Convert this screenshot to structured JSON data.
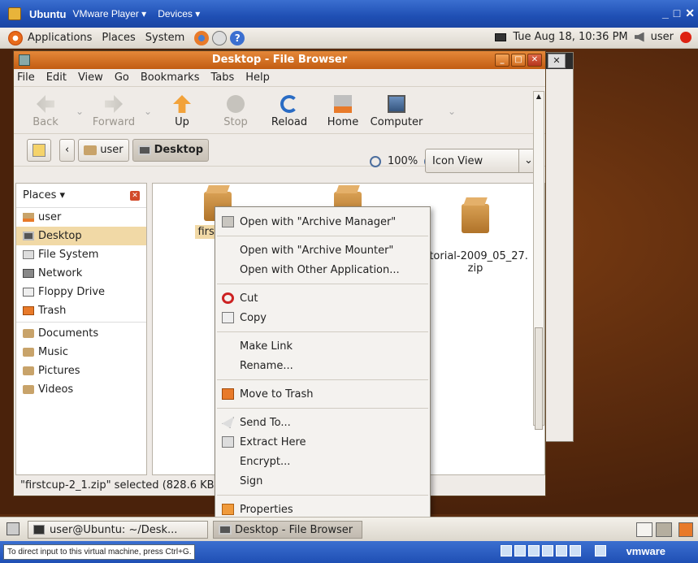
{
  "vmware": {
    "title": "Ubuntu",
    "menu_player": "VMware Player ▾",
    "menu_devices": "Devices ▾",
    "min": "_",
    "max": "□",
    "close": "✕",
    "hint": "To direct input to this virtual machine, press Ctrl+G.",
    "brand": "vmware"
  },
  "panel": {
    "applications": "Applications",
    "places": "Places",
    "system": "System",
    "datetime": "Tue Aug 18, 10:36 PM",
    "user": "user"
  },
  "window": {
    "title": "Desktop - File Browser",
    "menus": [
      "File",
      "Edit",
      "View",
      "Go",
      "Bookmarks",
      "Tabs",
      "Help"
    ],
    "toolbar": {
      "back": "Back",
      "forward": "Forward",
      "up": "Up",
      "stop": "Stop",
      "reload": "Reload",
      "home": "Home",
      "computer": "Computer"
    },
    "location": {
      "crumb_user": "user",
      "crumb_desktop": "Desktop",
      "zoom": "100%",
      "view": "Icon View"
    },
    "sidebar": {
      "header": "Places ▾",
      "items": [
        "user",
        "Desktop",
        "File System",
        "Network",
        "Floppy Drive",
        "Trash"
      ],
      "bookmarks": [
        "Documents",
        "Music",
        "Pictures",
        "Videos"
      ]
    },
    "files": [
      {
        "label": "firstcup"
      },
      {
        "label": ""
      },
      {
        "label": "utorial-2009_05_27.\nzip"
      }
    ],
    "status": "\"firstcup-2_1.zip\" selected (828.6 KB"
  },
  "context_menu": {
    "items": [
      "Open with \"Archive Manager\"",
      "Open with \"Archive Mounter\"",
      "Open with Other Application...",
      "Cut",
      "Copy",
      "Make Link",
      "Rename...",
      "Move to Trash",
      "Send To...",
      "Extract Here",
      "Encrypt...",
      "Sign",
      "Properties"
    ]
  },
  "taskbar": {
    "terminal": "user@Ubuntu: ~/Desk...",
    "file_browser": "Desktop - File Browser"
  }
}
